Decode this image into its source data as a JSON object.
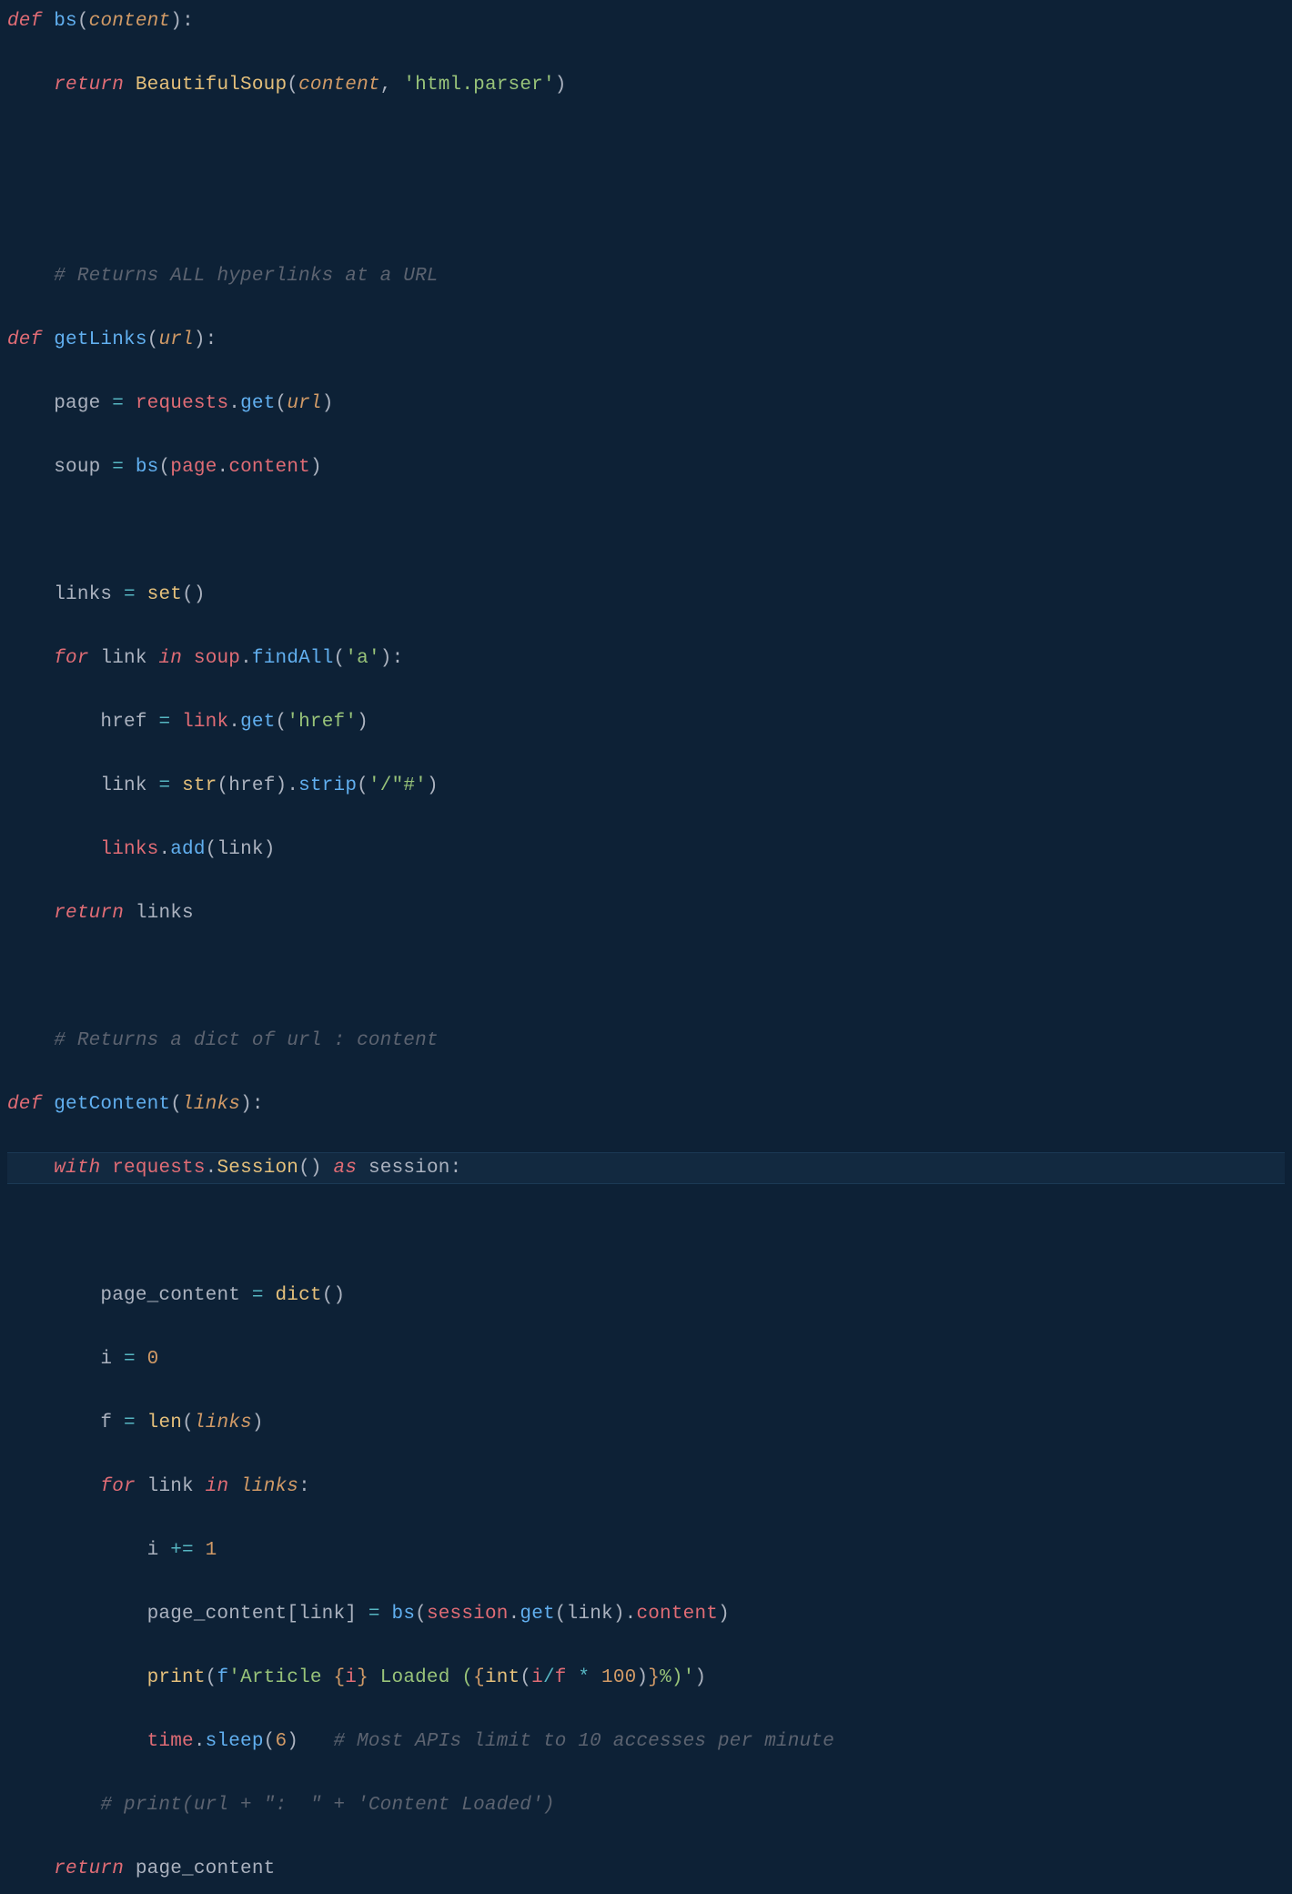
{
  "code": {
    "line01": "def bs(content):",
    "line02": "    return BeautifulSoup(content, 'html.parser')",
    "line03": "",
    "line04": "",
    "line05": "    # Returns ALL hyperlinks at a URL",
    "line06": "def getLinks(url):",
    "line07": "    page = requests.get(url)",
    "line08": "    soup = bs(page.content)",
    "line09": "",
    "line10": "    links = set()",
    "line11": "    for link in soup.findAll('a'):",
    "line12": "        href = link.get('href')",
    "line13": "        link = str(href).strip('/\"#')",
    "line14": "        links.add(link)",
    "line15": "    return links",
    "line16": "",
    "line17": "    # Returns a dict of url : content",
    "line18": "def getContent(links):",
    "line19": "    with requests.Session() as session:",
    "line20": "",
    "line21": "        page_content = dict()",
    "line22": "        i = 0",
    "line23": "        f = len(links)",
    "line24": "        for link in links:",
    "line25": "            i += 1",
    "line26": "            page_content[link] = bs(session.get(link).content)",
    "line27": "            print(f'Article {i} Loaded ({int(i/f * 100)}%)')",
    "line28": "            time.sleep(6)   # Most APIs limit to 10 accesses per minute",
    "line29": "        # print(url + \":  \" + 'Content Loaded')",
    "line30": "    return page_content"
  },
  "tokens": {
    "def": "def",
    "return": "return",
    "for": "for",
    "in": "in",
    "with": "with",
    "as": "as",
    "bs": "bs",
    "getLinks": "getLinks",
    "getContent": "getContent",
    "content": "content",
    "url": "url",
    "links_param": "links",
    "BeautifulSoup": "BeautifulSoup",
    "html_parser": "'html.parser'",
    "comment_hyperlinks": "# Returns ALL hyperlinks at a URL",
    "comment_dict": "# Returns a dict of url : content",
    "comment_api": "# Most APIs limit to 10 accesses per minute",
    "comment_print": "# print(url + \":  \" + 'Content Loaded')",
    "page": "page",
    "requests": "requests",
    "get": "get",
    "soup": "soup",
    "set": "set",
    "link": "link",
    "findAll": "findAll",
    "a_str": "'a'",
    "href": "href",
    "href_str": "'href'",
    "str": "str",
    "strip": "strip",
    "strip_chars": "'/\"#'",
    "add": "add",
    "Session": "Session",
    "session": "session",
    "page_content": "page_content",
    "dict": "dict",
    "i": "i",
    "zero": "0",
    "f": "f",
    "len": "len",
    "one": "1",
    "print": "print",
    "fprefix": "f",
    "farticle": "'Article ",
    "floaded": " Loaded (",
    "fpct": "%)'",
    "int": "int",
    "slash": "/",
    "star": "*",
    "hundred": "100",
    "time": "time",
    "sleep": "sleep",
    "six": "6",
    "plusequal": "+=",
    "equal": "=",
    "dot": ".",
    "comma": ",",
    "colon": ":",
    "lparen": "(",
    "rparen": ")",
    "lbrack": "[",
    "rbrack": "]",
    "lbrace": "{",
    "rbrace": "}"
  }
}
